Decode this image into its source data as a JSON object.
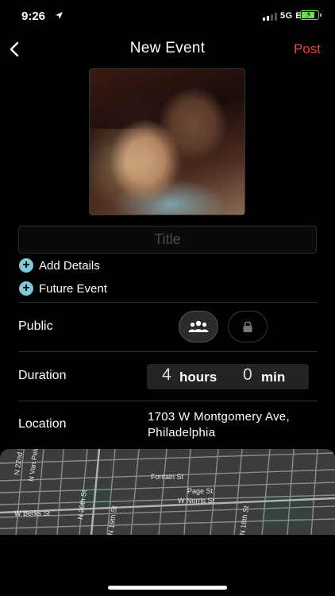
{
  "status": {
    "time": "9:26",
    "network": "5G E"
  },
  "nav": {
    "title": "New Event",
    "post_label": "Post"
  },
  "form": {
    "title_placeholder": "Title",
    "add_details_label": "Add Details",
    "future_event_label": "Future Event",
    "privacy_label": "Public",
    "duration_label": "Duration",
    "duration_hours": "4",
    "duration_hours_unit": "hours",
    "duration_minutes": "0",
    "duration_minutes_unit": "min",
    "location_label": "Location",
    "location_line1": "1703 W Montgomery Ave,",
    "location_line2": "Philadelphia"
  },
  "map": {
    "streets": [
      "N 22nd St",
      "N Van Pelt",
      "Fontain St",
      "Page St",
      "W Norris St",
      "W Berks St",
      "N 20th St",
      "N 19th St",
      "N 18th St"
    ]
  },
  "colors": {
    "accent_red": "#e8453c",
    "plus_icon": "#7ec8d8",
    "battery": "#6fdc57"
  },
  "battery_level": 0.85
}
